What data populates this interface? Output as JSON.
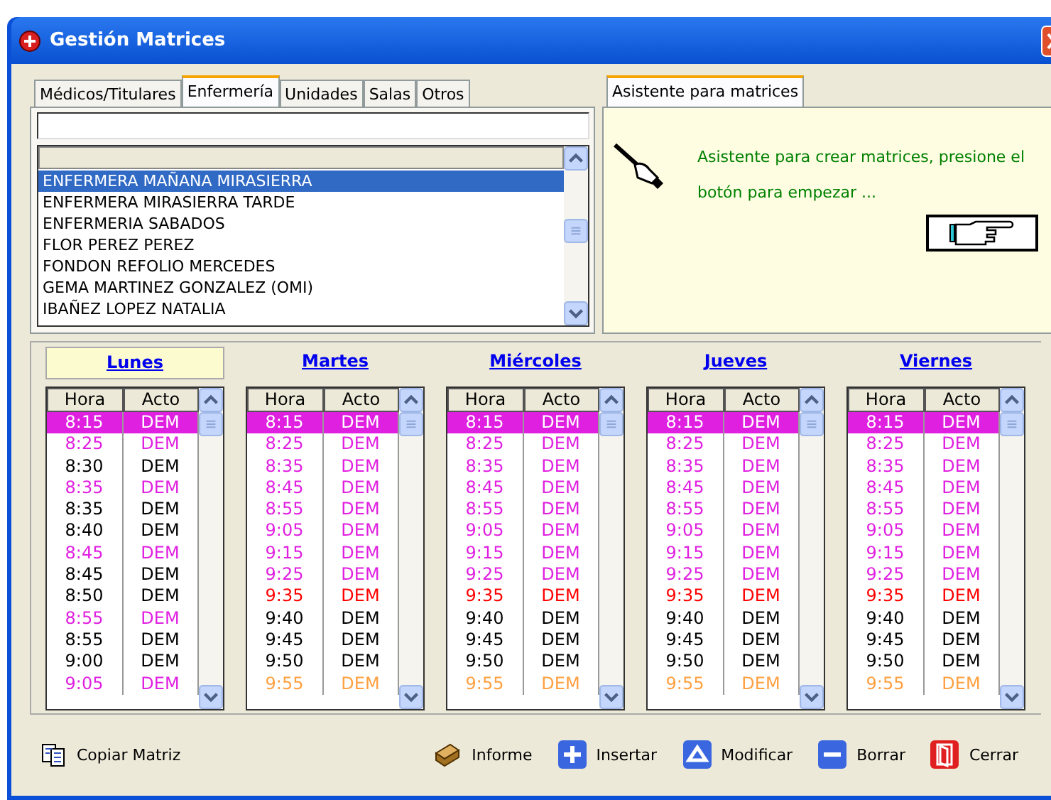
{
  "window": {
    "title": "Gestión Matrices"
  },
  "tabs": [
    {
      "label": "Médicos/Titulares",
      "selected": false
    },
    {
      "label": "Enfermería",
      "selected": true
    },
    {
      "label": "Unidades",
      "selected": false
    },
    {
      "label": "Salas",
      "selected": false
    },
    {
      "label": "Otros",
      "selected": false
    }
  ],
  "list": {
    "items": [
      {
        "label": "ENFERMERA MAÑANA MIRASIERRA",
        "selected": true
      },
      {
        "label": "ENFERMERA MIRASIERRA TARDE",
        "selected": false
      },
      {
        "label": "ENFERMERIA SABADOS",
        "selected": false
      },
      {
        "label": "FLOR PEREZ PEREZ",
        "selected": false
      },
      {
        "label": "FONDON REFOLIO MERCEDES",
        "selected": false
      },
      {
        "label": "GEMA MARTINEZ GONZALEZ (OMI)",
        "selected": false
      },
      {
        "label": "IBAÑEZ LOPEZ NATALIA",
        "selected": false
      }
    ]
  },
  "wizard": {
    "tab": "Asistente para matrices",
    "message": "Asistente para crear matrices, presione el botón para empezar ..."
  },
  "days": [
    {
      "name": "Lunes",
      "selected": true,
      "columns": [
        "Hora",
        "Acto"
      ],
      "rows": [
        {
          "hora": "8:15",
          "acto": "DEM",
          "color": "#e020e0",
          "selected": true
        },
        {
          "hora": "8:25",
          "acto": "DEM",
          "color": "#e020e0",
          "selected": false
        },
        {
          "hora": "8:30",
          "acto": "DEM",
          "color": "#000000",
          "selected": false
        },
        {
          "hora": "8:35",
          "acto": "DEM",
          "color": "#e020e0",
          "selected": false
        },
        {
          "hora": "8:35",
          "acto": "DEM",
          "color": "#000000",
          "selected": false
        },
        {
          "hora": "8:40",
          "acto": "DEM",
          "color": "#000000",
          "selected": false
        },
        {
          "hora": "8:45",
          "acto": "DEM",
          "color": "#e020e0",
          "selected": false
        },
        {
          "hora": "8:45",
          "acto": "DEM",
          "color": "#000000",
          "selected": false
        },
        {
          "hora": "8:50",
          "acto": "DEM",
          "color": "#000000",
          "selected": false
        },
        {
          "hora": "8:55",
          "acto": "DEM",
          "color": "#e020e0",
          "selected": false
        },
        {
          "hora": "8:55",
          "acto": "DEM",
          "color": "#000000",
          "selected": false
        },
        {
          "hora": "9:00",
          "acto": "DEM",
          "color": "#000000",
          "selected": false
        },
        {
          "hora": "9:05",
          "acto": "DEM",
          "color": "#e020e0",
          "selected": false
        }
      ]
    },
    {
      "name": "Martes",
      "selected": false,
      "columns": [
        "Hora",
        "Acto"
      ],
      "rows": [
        {
          "hora": "8:15",
          "acto": "DEM",
          "color": "#e020e0",
          "selected": true
        },
        {
          "hora": "8:25",
          "acto": "DEM",
          "color": "#e020e0",
          "selected": false
        },
        {
          "hora": "8:35",
          "acto": "DEM",
          "color": "#e020e0",
          "selected": false
        },
        {
          "hora": "8:45",
          "acto": "DEM",
          "color": "#e020e0",
          "selected": false
        },
        {
          "hora": "8:55",
          "acto": "DEM",
          "color": "#e020e0",
          "selected": false
        },
        {
          "hora": "9:05",
          "acto": "DEM",
          "color": "#e020e0",
          "selected": false
        },
        {
          "hora": "9:15",
          "acto": "DEM",
          "color": "#e020e0",
          "selected": false
        },
        {
          "hora": "9:25",
          "acto": "DEM",
          "color": "#e020e0",
          "selected": false
        },
        {
          "hora": "9:35",
          "acto": "DEM",
          "color": "#ff0000",
          "selected": false
        },
        {
          "hora": "9:40",
          "acto": "DEM",
          "color": "#000000",
          "selected": false
        },
        {
          "hora": "9:45",
          "acto": "DEM",
          "color": "#000000",
          "selected": false
        },
        {
          "hora": "9:50",
          "acto": "DEM",
          "color": "#000000",
          "selected": false
        },
        {
          "hora": "9:55",
          "acto": "DEM",
          "color": "#ffa040",
          "selected": false
        }
      ]
    },
    {
      "name": "Miércoles",
      "selected": false,
      "columns": [
        "Hora",
        "Acto"
      ],
      "rows": [
        {
          "hora": "8:15",
          "acto": "DEM",
          "color": "#e020e0",
          "selected": true
        },
        {
          "hora": "8:25",
          "acto": "DEM",
          "color": "#e020e0",
          "selected": false
        },
        {
          "hora": "8:35",
          "acto": "DEM",
          "color": "#e020e0",
          "selected": false
        },
        {
          "hora": "8:45",
          "acto": "DEM",
          "color": "#e020e0",
          "selected": false
        },
        {
          "hora": "8:55",
          "acto": "DEM",
          "color": "#e020e0",
          "selected": false
        },
        {
          "hora": "9:05",
          "acto": "DEM",
          "color": "#e020e0",
          "selected": false
        },
        {
          "hora": "9:15",
          "acto": "DEM",
          "color": "#e020e0",
          "selected": false
        },
        {
          "hora": "9:25",
          "acto": "DEM",
          "color": "#e020e0",
          "selected": false
        },
        {
          "hora": "9:35",
          "acto": "DEM",
          "color": "#ff0000",
          "selected": false
        },
        {
          "hora": "9:40",
          "acto": "DEM",
          "color": "#000000",
          "selected": false
        },
        {
          "hora": "9:45",
          "acto": "DEM",
          "color": "#000000",
          "selected": false
        },
        {
          "hora": "9:50",
          "acto": "DEM",
          "color": "#000000",
          "selected": false
        },
        {
          "hora": "9:55",
          "acto": "DEM",
          "color": "#ffa040",
          "selected": false
        }
      ]
    },
    {
      "name": "Jueves",
      "selected": false,
      "columns": [
        "Hora",
        "Acto"
      ],
      "rows": [
        {
          "hora": "8:15",
          "acto": "DEM",
          "color": "#e020e0",
          "selected": true
        },
        {
          "hora": "8:25",
          "acto": "DEM",
          "color": "#e020e0",
          "selected": false
        },
        {
          "hora": "8:35",
          "acto": "DEM",
          "color": "#e020e0",
          "selected": false
        },
        {
          "hora": "8:45",
          "acto": "DEM",
          "color": "#e020e0",
          "selected": false
        },
        {
          "hora": "8:55",
          "acto": "DEM",
          "color": "#e020e0",
          "selected": false
        },
        {
          "hora": "9:05",
          "acto": "DEM",
          "color": "#e020e0",
          "selected": false
        },
        {
          "hora": "9:15",
          "acto": "DEM",
          "color": "#e020e0",
          "selected": false
        },
        {
          "hora": "9:25",
          "acto": "DEM",
          "color": "#e020e0",
          "selected": false
        },
        {
          "hora": "9:35",
          "acto": "DEM",
          "color": "#ff0000",
          "selected": false
        },
        {
          "hora": "9:40",
          "acto": "DEM",
          "color": "#000000",
          "selected": false
        },
        {
          "hora": "9:45",
          "acto": "DEM",
          "color": "#000000",
          "selected": false
        },
        {
          "hora": "9:50",
          "acto": "DEM",
          "color": "#000000",
          "selected": false
        },
        {
          "hora": "9:55",
          "acto": "DEM",
          "color": "#ffa040",
          "selected": false
        }
      ]
    },
    {
      "name": "Viernes",
      "selected": false,
      "columns": [
        "Hora",
        "Acto"
      ],
      "rows": [
        {
          "hora": "8:15",
          "acto": "DEM",
          "color": "#e020e0",
          "selected": true
        },
        {
          "hora": "8:25",
          "acto": "DEM",
          "color": "#e020e0",
          "selected": false
        },
        {
          "hora": "8:35",
          "acto": "DEM",
          "color": "#e020e0",
          "selected": false
        },
        {
          "hora": "8:45",
          "acto": "DEM",
          "color": "#e020e0",
          "selected": false
        },
        {
          "hora": "8:55",
          "acto": "DEM",
          "color": "#e020e0",
          "selected": false
        },
        {
          "hora": "9:05",
          "acto": "DEM",
          "color": "#e020e0",
          "selected": false
        },
        {
          "hora": "9:15",
          "acto": "DEM",
          "color": "#e020e0",
          "selected": false
        },
        {
          "hora": "9:25",
          "acto": "DEM",
          "color": "#e020e0",
          "selected": false
        },
        {
          "hora": "9:35",
          "acto": "DEM",
          "color": "#ff0000",
          "selected": false
        },
        {
          "hora": "9:40",
          "acto": "DEM",
          "color": "#000000",
          "selected": false
        },
        {
          "hora": "9:45",
          "acto": "DEM",
          "color": "#000000",
          "selected": false
        },
        {
          "hora": "9:50",
          "acto": "DEM",
          "color": "#000000",
          "selected": false
        },
        {
          "hora": "9:55",
          "acto": "DEM",
          "color": "#ffa040",
          "selected": false
        }
      ]
    }
  ],
  "buttons": [
    {
      "label": "Copiar Matriz",
      "kind": "copy"
    },
    {
      "label": "Informe",
      "kind": "report"
    },
    {
      "label": "Insertar",
      "kind": "insert"
    },
    {
      "label": "Modificar",
      "kind": "edit"
    },
    {
      "label": "Borrar",
      "kind": "delete"
    },
    {
      "label": "Cerrar",
      "kind": "close"
    }
  ]
}
